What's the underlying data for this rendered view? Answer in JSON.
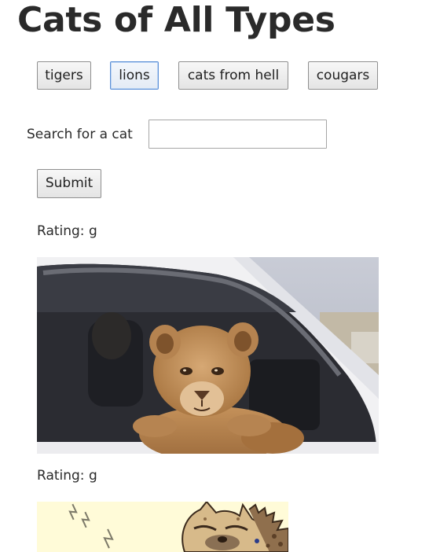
{
  "page": {
    "title": "Cats of All Types"
  },
  "topic_buttons": [
    {
      "label": "tigers"
    },
    {
      "label": "lions"
    },
    {
      "label": "cats from hell"
    },
    {
      "label": "cougars"
    }
  ],
  "search": {
    "label": "Search for a cat",
    "value": "",
    "placeholder": "",
    "submit_label": "Submit"
  },
  "results": [
    {
      "rating_text": "Rating: g",
      "image": "lion-cub-in-car-window"
    },
    {
      "rating_text": "Rating: g",
      "image": "sleeping-hyena-cartoon",
      "caption": "Z Z Z"
    }
  ],
  "colors": {
    "focused_button_border": "#5b8fd6",
    "button_border": "#8f8f8f",
    "title": "#2a2a2a"
  }
}
